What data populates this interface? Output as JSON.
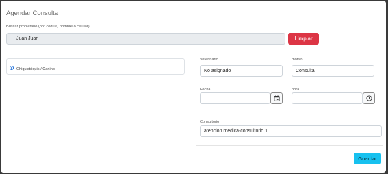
{
  "modal": {
    "title": "Agendar Consulta"
  },
  "search": {
    "label": "Buscar propietario (por cédula, nombre o celular)",
    "value": "Juan Juan",
    "clear_label": "Limpiar"
  },
  "pets": [
    {
      "label": "Chiquistriquis / Canino",
      "selected": true
    }
  ],
  "form": {
    "vet_label": "Veterinario",
    "vet_value": "No asignado",
    "reason_label": "motivo",
    "reason_value": "Consulta",
    "date_label": "Fecha",
    "date_value": "",
    "time_label": "hora",
    "time_value": "",
    "office_label": "Consultorio",
    "office_value": "atencion medica-consultorio 1"
  },
  "actions": {
    "save_label": "Guardar"
  },
  "colors": {
    "danger": "#dc3545",
    "save": "#17c1ef",
    "radio": "#1e6fd9"
  },
  "icons": {
    "date": "calendar-icon",
    "time": "clock-icon"
  }
}
